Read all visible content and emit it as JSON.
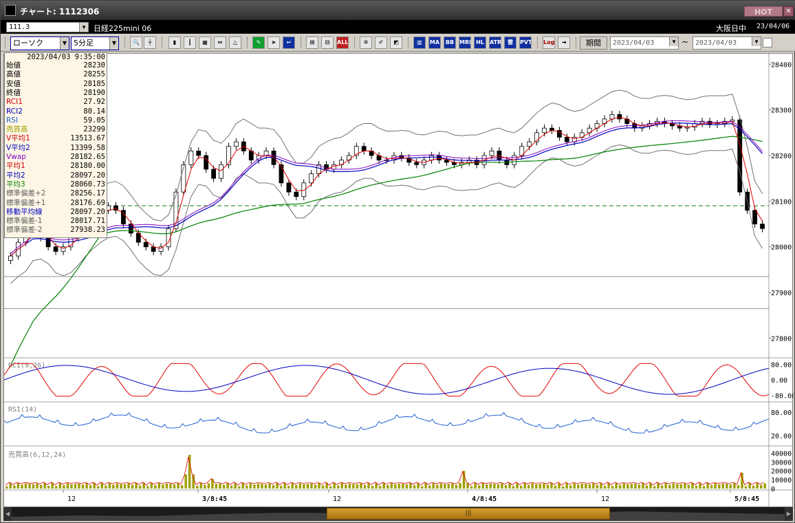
{
  "window": {
    "title": "チャート: 1112306",
    "hot_label": "HOT",
    "close_label": "✕"
  },
  "header": {
    "code": "111.3",
    "symbol": "日経225mini 06",
    "exchange": "大阪日中",
    "date": "23/04/06"
  },
  "toolbar": {
    "chart_type": "ローソク",
    "timeframe": "5分足",
    "period_label": "期間",
    "date_from": "2023/04/03",
    "date_to": "2023/04/03",
    "tilde": "~",
    "icons": [
      "search-icon",
      "crosshair-icon",
      "candle-icon",
      "bar-icon",
      "compare-icon",
      "lock-icon",
      "pen-icon",
      "cursor-icon",
      "arrow-icon",
      "zoom-in-icon",
      "zoom-out-icon",
      "all-icon",
      "tools-icon",
      "brush-icon",
      "palette-icon",
      "volume-icon",
      "ma-icon",
      "bb-icon",
      "mre-icon",
      "hl-icon",
      "atr-icon",
      "ichimoku-icon",
      "pvt-icon",
      "log-icon",
      "exit-icon"
    ],
    "button_text": {
      "all": "ALL",
      "ma": "MA",
      "bb": "BB",
      "mre": "MRE",
      "hl": "HL",
      "atr": "ATR",
      "pvt": "PVT",
      "log": "Log"
    }
  },
  "data_panel": {
    "time": "2023/04/03 9:35:00",
    "rows": [
      {
        "label": "始値",
        "value": "28230",
        "color": "#000000"
      },
      {
        "label": "高値",
        "value": "28255",
        "color": "#000000"
      },
      {
        "label": "安値",
        "value": "28185",
        "color": "#000000"
      },
      {
        "label": "終値",
        "value": "28190",
        "color": "#000000"
      },
      {
        "label": "RCI1",
        "value": "27.92",
        "color": "#d00000"
      },
      {
        "label": "RCI2",
        "value": "80.14",
        "color": "#0000c0"
      },
      {
        "label": "RSI",
        "value": "59.05",
        "color": "#2060d0"
      },
      {
        "label": "売買高",
        "value": "23299",
        "color": "#a0a000"
      },
      {
        "label": "V平均1",
        "value": "13513.67",
        "color": "#d00000"
      },
      {
        "label": "V平均2",
        "value": "13399.58",
        "color": "#0000c0"
      },
      {
        "label": "Vwap",
        "value": "28182.65",
        "color": "#8000c0"
      },
      {
        "label": "平均1",
        "value": "28180.00",
        "color": "#d00000"
      },
      {
        "label": "平均2",
        "value": "28097.20",
        "color": "#0000c0"
      },
      {
        "label": "平均3",
        "value": "28060.73",
        "color": "#008000"
      },
      {
        "label": "標準偏差+2",
        "value": "28256.17",
        "color": "#606060"
      },
      {
        "label": "標準偏差+1",
        "value": "28176.69",
        "color": "#606060"
      },
      {
        "label": "移動平均線",
        "value": "28097.20",
        "color": "#0000c0"
      },
      {
        "label": "標準偏差-1",
        "value": "28017.71",
        "color": "#606060"
      },
      {
        "label": "標準偏差-2",
        "value": "27938.23",
        "color": "#606060"
      }
    ]
  },
  "chart_data": [
    {
      "type": "candlestick",
      "title": "",
      "price_axis_ticks": [
        "28400",
        "28300",
        "28200",
        "28100",
        "28000",
        "27900",
        "27800"
      ],
      "ylim": [
        27760,
        28420
      ],
      "x_tick_labels": [
        "12",
        "3/8:45",
        "12",
        "4/8:45",
        "12",
        "5/8:45"
      ],
      "reference_line": 28090,
      "close_path": [
        27980,
        28010,
        28030,
        28050,
        28020,
        28000,
        27990,
        28000,
        28020,
        28040,
        28060,
        28070,
        28080,
        28090,
        28080,
        28050,
        28030,
        28010,
        28000,
        27990,
        28000,
        28040,
        28120,
        28180,
        28210,
        28200,
        28170,
        28150,
        28180,
        28220,
        28230,
        28210,
        28190,
        28200,
        28210,
        28180,
        28140,
        28120,
        28110,
        28140,
        28160,
        28180,
        28170,
        28180,
        28190,
        28200,
        28220,
        28210,
        28200,
        28190,
        28190,
        28200,
        28195,
        28185,
        28180,
        28190,
        28200,
        28190,
        28185,
        28180,
        28185,
        28190,
        28180,
        28200,
        28210,
        28190,
        28180,
        28200,
        28220,
        28230,
        28250,
        28260,
        28255,
        28240,
        28230,
        28240,
        28250,
        28260,
        28270,
        28280,
        28290,
        28280,
        28270,
        28260,
        28265,
        28270,
        28275,
        28270,
        28265,
        28260,
        28262,
        28270,
        28275,
        28268,
        28270,
        28275,
        28278,
        28120,
        28080,
        28050,
        28040
      ]
    },
    {
      "type": "line",
      "title": "RCI(9,26)",
      "axis_ticks": [
        "80.00",
        "0.00",
        "-80.00"
      ],
      "ylim": [
        -100,
        100
      ]
    },
    {
      "type": "line",
      "title": "RSI(14)",
      "axis_ticks": [
        "80.00",
        "20.00"
      ],
      "ylim": [
        0,
        100
      ]
    },
    {
      "type": "bar",
      "title": "売買高(6,12,24)",
      "axis_ticks": [
        "40000",
        "30000",
        "20000",
        "10000",
        "0"
      ],
      "ylim": [
        0,
        45000
      ]
    }
  ],
  "colors": {
    "rci1": "#e00000",
    "rci2": "#0000c0",
    "rsi": "#2060d0",
    "ma_short": "#e00000",
    "ma_mid": "#0000c0",
    "ma_long": "#008000",
    "vwap": "#8000c0",
    "volume": "#a0a000",
    "band": "#707070"
  }
}
